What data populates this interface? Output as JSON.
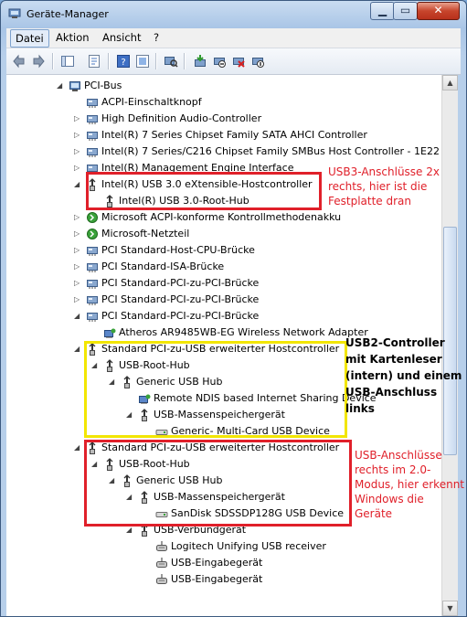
{
  "window": {
    "title": "Geräte-Manager"
  },
  "menu": [
    {
      "label": "Datei"
    },
    {
      "label": "Aktion"
    },
    {
      "label": "Ansicht"
    },
    {
      "label": "?"
    }
  ],
  "tree": [
    {
      "label": "PCI-Bus",
      "level": 0,
      "expander": "open",
      "icon": "pci-bus-icon"
    },
    {
      "label": "ACPI-Einschaltknopf",
      "level": 1,
      "expander": "none",
      "icon": "device-icon"
    },
    {
      "label": "High Definition Audio-Controller",
      "level": 1,
      "expander": "closed",
      "icon": "device-icon"
    },
    {
      "label": "Intel(R) 7 Series Chipset Family SATA AHCI Controller",
      "level": 1,
      "expander": "closed",
      "icon": "device-icon"
    },
    {
      "label": "Intel(R) 7 Series/C216 Chipset Family SMBus Host Controller - 1E22",
      "level": 1,
      "expander": "closed",
      "icon": "device-icon"
    },
    {
      "label": "Intel(R) Management Engine Interface",
      "level": 1,
      "expander": "closed",
      "icon": "device-icon"
    },
    {
      "label": "Intel(R) USB 3.0 eXtensible-Hostcontroller",
      "level": 1,
      "expander": "open",
      "icon": "usb-icon"
    },
    {
      "label": "Intel(R) USB 3.0-Root-Hub",
      "level": 2,
      "expander": "none",
      "icon": "usb-icon"
    },
    {
      "label": "Microsoft ACPI-konforme Kontrollmethodenakku",
      "level": 1,
      "expander": "closed",
      "icon": "battery-icon"
    },
    {
      "label": "Microsoft-Netzteil",
      "level": 1,
      "expander": "closed",
      "icon": "battery-icon"
    },
    {
      "label": "PCI Standard-Host-CPU-Brücke",
      "level": 1,
      "expander": "closed",
      "icon": "device-icon"
    },
    {
      "label": "PCI Standard-ISA-Brücke",
      "level": 1,
      "expander": "closed",
      "icon": "device-icon"
    },
    {
      "label": "PCI Standard-PCI-zu-PCI-Brücke",
      "level": 1,
      "expander": "closed",
      "icon": "device-icon"
    },
    {
      "label": "PCI Standard-PCI-zu-PCI-Brücke",
      "level": 1,
      "expander": "closed",
      "icon": "device-icon"
    },
    {
      "label": "PCI Standard-PCI-zu-PCI-Brücke",
      "level": 1,
      "expander": "open",
      "icon": "device-icon"
    },
    {
      "label": "Atheros AR9485WB-EG Wireless Network Adapter",
      "level": 2,
      "expander": "none",
      "icon": "network-icon"
    },
    {
      "label": "Standard PCI-zu-USB erweiterter Hostcontroller",
      "level": 1,
      "expander": "open",
      "icon": "usb-icon"
    },
    {
      "label": "USB-Root-Hub",
      "level": 2,
      "expander": "open",
      "icon": "usb-icon"
    },
    {
      "label": "Generic USB Hub",
      "level": 3,
      "expander": "open",
      "icon": "usb-icon"
    },
    {
      "label": "Remote NDIS based Internet Sharing Device",
      "level": 4,
      "expander": "none",
      "icon": "network-icon"
    },
    {
      "label": "USB-Massenspeichergerät",
      "level": 4,
      "expander": "open",
      "icon": "usb-icon"
    },
    {
      "label": "Generic- Multi-Card USB Device",
      "level": 5,
      "expander": "none",
      "icon": "drive-icon"
    },
    {
      "label": "Standard PCI-zu-USB erweiterter Hostcontroller",
      "level": 1,
      "expander": "open",
      "icon": "usb-icon"
    },
    {
      "label": "USB-Root-Hub",
      "level": 2,
      "expander": "open",
      "icon": "usb-icon"
    },
    {
      "label": "Generic USB Hub",
      "level": 3,
      "expander": "open",
      "icon": "usb-icon"
    },
    {
      "label": "USB-Massenspeichergerät",
      "level": 4,
      "expander": "open",
      "icon": "usb-icon"
    },
    {
      "label": "SanDisk SDSSDP128G USB Device",
      "level": 5,
      "expander": "none",
      "icon": "drive-icon"
    },
    {
      "label": "USB-Verbundgerät",
      "level": 4,
      "expander": "open",
      "icon": "usb-icon"
    },
    {
      "label": "Logitech Unifying USB receiver",
      "level": 5,
      "expander": "none",
      "icon": "input-device-icon"
    },
    {
      "label": "USB-Eingabegerät",
      "level": 5,
      "expander": "none",
      "icon": "input-device-icon"
    },
    {
      "label": "USB-Eingabegerät",
      "level": 5,
      "expander": "none",
      "icon": "input-device-icon"
    }
  ],
  "annotations": {
    "usb3": {
      "text": "USB3-Anschlüsse 2x rechts, hier ist die Festplatte dran",
      "color": "#e0202a"
    },
    "usb2_internal": {
      "text": "USB2-Controller mit Kartenleser (intern) und einem USB-Anschluss links",
      "color": "#f2e600"
    },
    "usb2_right": {
      "text": "USB-Anschlüsse rechts im 2.0-Modus, hier erkennt Windows die Geräte",
      "color": "#e0202a"
    }
  }
}
